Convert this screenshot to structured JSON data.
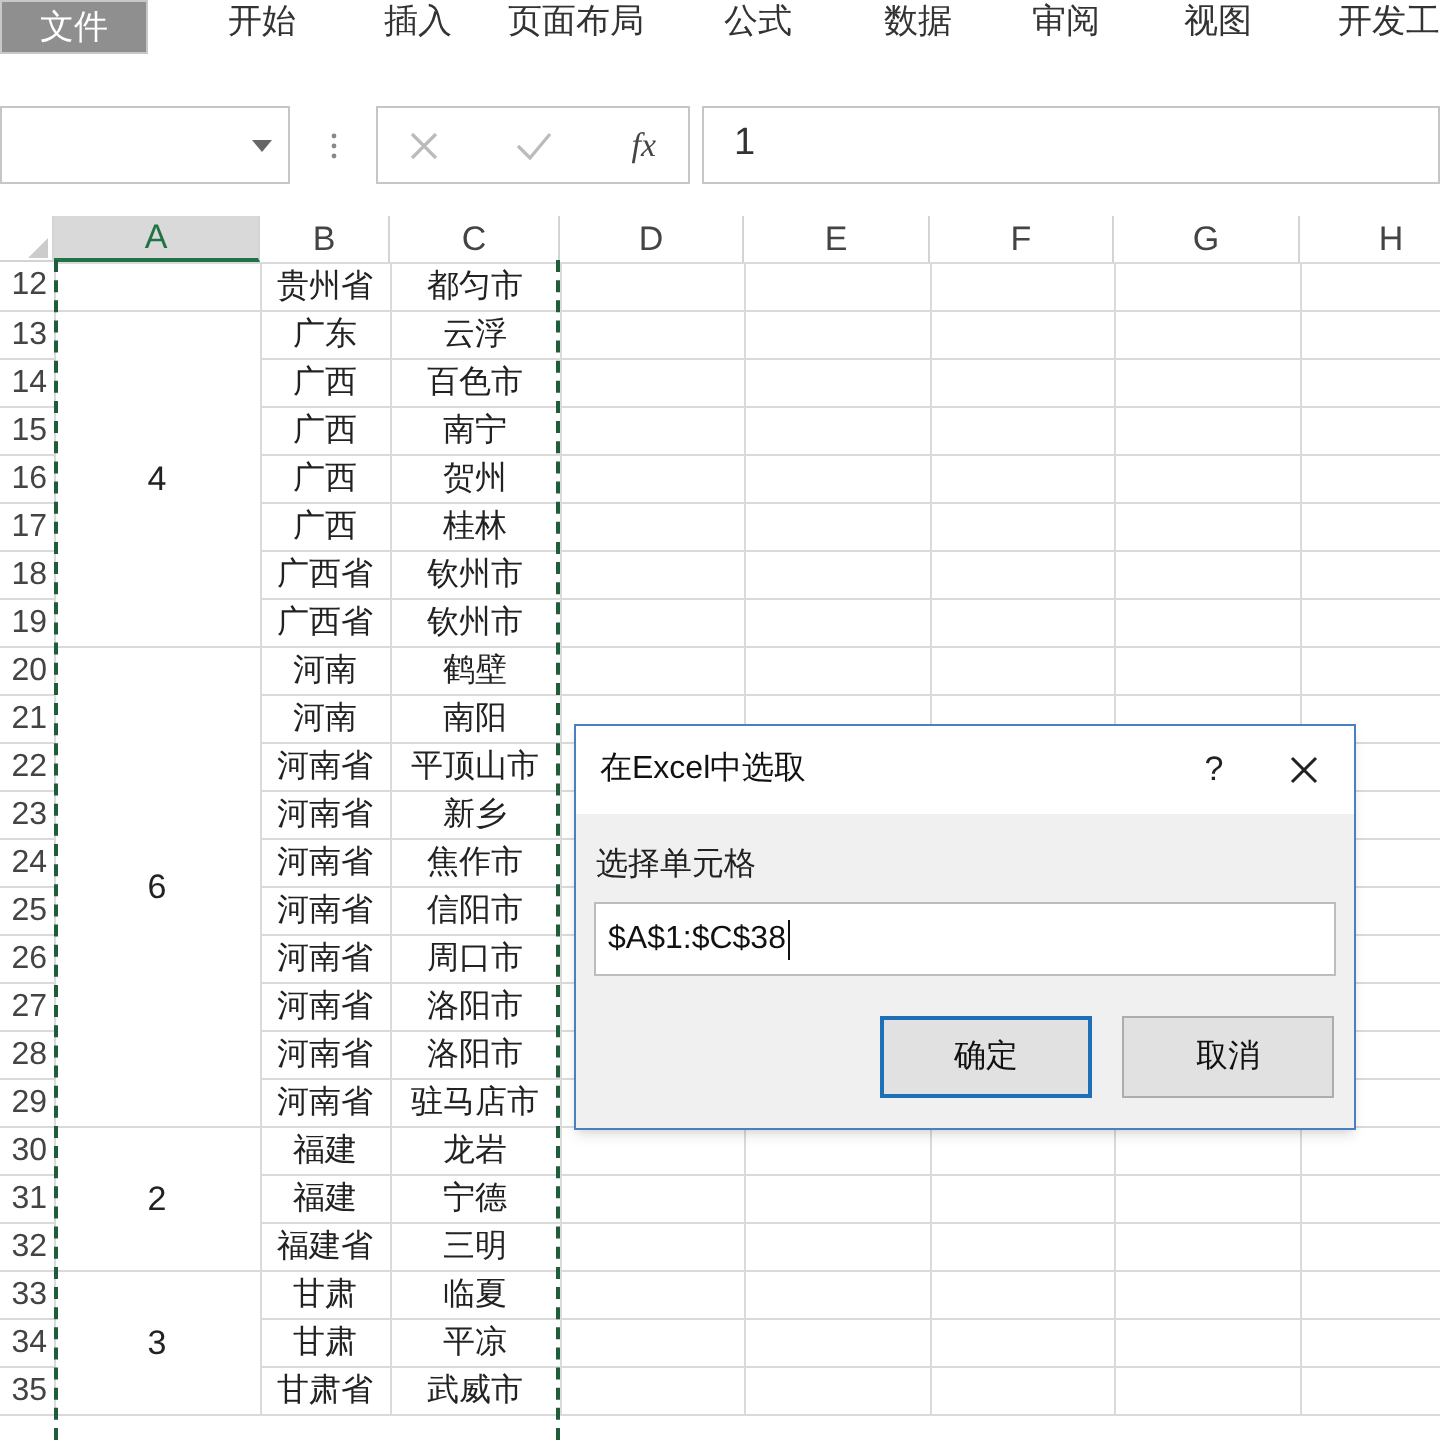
{
  "ribbon": {
    "tabs": [
      {
        "label": "文件",
        "kind": "file"
      },
      {
        "label": "开始",
        "kind": "tab"
      },
      {
        "label": "插入",
        "kind": "tab"
      },
      {
        "label": "页面布局",
        "kind": "tab"
      },
      {
        "label": "公式",
        "kind": "tab"
      },
      {
        "label": "数据",
        "kind": "tab"
      },
      {
        "label": "审阅",
        "kind": "tab"
      },
      {
        "label": "视图",
        "kind": "tab"
      },
      {
        "label": "开发工",
        "kind": "tab"
      }
    ]
  },
  "formula_bar": {
    "function_label": "fx",
    "cancel_disabled": true,
    "enter_disabled": true,
    "value": "1"
  },
  "sheet": {
    "columns": [
      {
        "label": "A",
        "selected": true
      },
      {
        "label": "B",
        "selected": false
      },
      {
        "label": "C",
        "selected": false
      },
      {
        "label": "D",
        "selected": false
      },
      {
        "label": "E",
        "selected": false
      },
      {
        "label": "F",
        "selected": false
      },
      {
        "label": "G",
        "selected": false
      },
      {
        "label": "H",
        "selected": false
      }
    ],
    "copy_marquee": true,
    "groups": [
      {
        "rows": [
          {
            "number": "12",
            "b": "贵州省",
            "c": "都匀市"
          }
        ]
      },
      {
        "a": "4",
        "rows": [
          {
            "number": "13",
            "b": "广东",
            "c": "云浮"
          },
          {
            "number": "14",
            "b": "广西",
            "c": "百色市"
          },
          {
            "number": "15",
            "b": "广西",
            "c": "南宁"
          },
          {
            "number": "16",
            "b": "广西",
            "c": "贺州"
          },
          {
            "number": "17",
            "b": "广西",
            "c": "桂林"
          },
          {
            "number": "18",
            "b": "广西省",
            "c": "钦州市"
          },
          {
            "number": "19",
            "b": "广西省",
            "c": "钦州市"
          }
        ]
      },
      {
        "a": "6",
        "rows": [
          {
            "number": "20",
            "b": "河南",
            "c": "鹤壁"
          },
          {
            "number": "21",
            "b": "河南",
            "c": "南阳"
          },
          {
            "number": "22",
            "b": "河南省",
            "c": "平顶山市"
          },
          {
            "number": "23",
            "b": "河南省",
            "c": "新乡"
          },
          {
            "number": "24",
            "b": "河南省",
            "c": "焦作市"
          },
          {
            "number": "25",
            "b": "河南省",
            "c": "信阳市"
          },
          {
            "number": "26",
            "b": "河南省",
            "c": "周口市"
          },
          {
            "number": "27",
            "b": "河南省",
            "c": "洛阳市"
          },
          {
            "number": "28",
            "b": "河南省",
            "c": "洛阳市"
          },
          {
            "number": "29",
            "b": "河南省",
            "c": "驻马店市"
          }
        ]
      },
      {
        "a": "2",
        "rows": [
          {
            "number": "30",
            "b": "福建",
            "c": "龙岩"
          },
          {
            "number": "31",
            "b": "福建",
            "c": "宁德"
          },
          {
            "number": "32",
            "b": "福建省",
            "c": "三明"
          }
        ]
      },
      {
        "a": "3",
        "rows": [
          {
            "number": "33",
            "b": "甘肃",
            "c": "临夏"
          },
          {
            "number": "34",
            "b": "甘肃",
            "c": "平凉"
          },
          {
            "number": "35",
            "b": "甘肃省",
            "c": "武威市"
          }
        ]
      }
    ]
  },
  "dialog": {
    "title": "在Excel中选取",
    "help": "?",
    "label": "选择单元格",
    "value": "$A$1:$C$38",
    "buttons": [
      {
        "label": "确定",
        "focused": true
      },
      {
        "label": "取消",
        "focused": false
      }
    ]
  }
}
